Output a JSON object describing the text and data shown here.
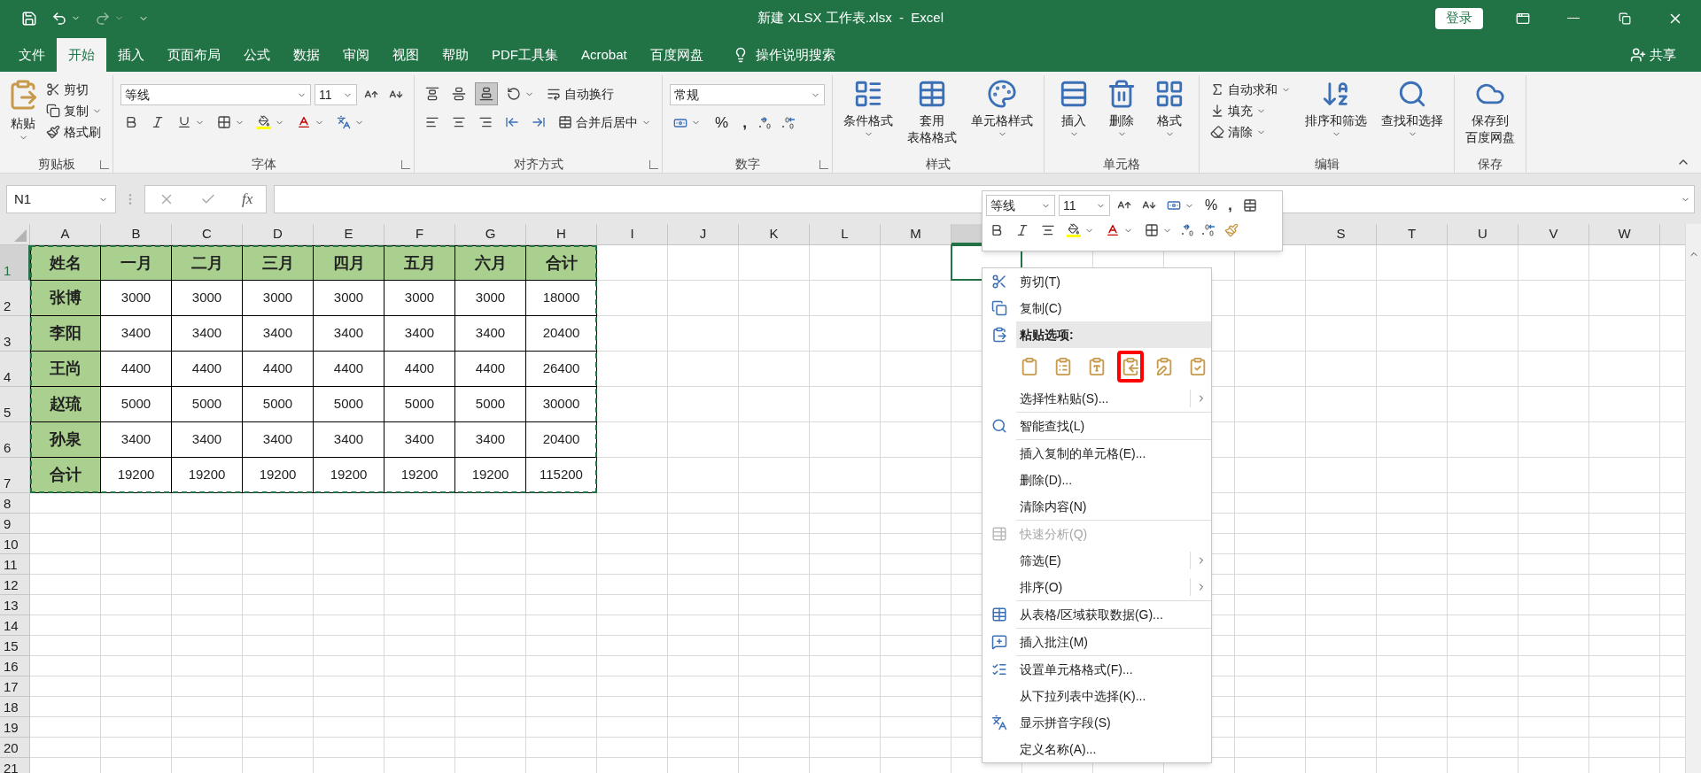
{
  "title_bar": {
    "title": "新建 XLSX 工作表.xlsx  -  Excel",
    "login": "登录"
  },
  "menu_tabs": [
    {
      "label": "文件",
      "selected": false
    },
    {
      "label": "开始",
      "selected": true
    },
    {
      "label": "插入",
      "selected": false
    },
    {
      "label": "页面布局",
      "selected": false
    },
    {
      "label": "公式",
      "selected": false
    },
    {
      "label": "数据",
      "selected": false
    },
    {
      "label": "审阅",
      "selected": false
    },
    {
      "label": "视图",
      "selected": false
    },
    {
      "label": "帮助",
      "selected": false
    },
    {
      "label": "PDF工具集",
      "selected": false
    },
    {
      "label": "Acrobat",
      "selected": false
    },
    {
      "label": "百度网盘",
      "selected": false
    }
  ],
  "tell_me": "操作说明搜索",
  "share": "共享",
  "ribbon": {
    "groups": [
      {
        "kind": "clipboard",
        "label": "剪贴板",
        "launcher": true,
        "paste": "粘贴",
        "items": [
          "剪切",
          "复制",
          "格式刷"
        ]
      },
      {
        "kind": "font",
        "label": "字体",
        "launcher": true,
        "font": "等线",
        "size": "11"
      },
      {
        "kind": "alignment",
        "label": "对齐方式",
        "launcher": true,
        "wrap": "自动换行",
        "merge": "合并后居中"
      },
      {
        "kind": "number",
        "label": "数字",
        "launcher": true,
        "format": "常规",
        "percent": "%",
        "comma": ","
      },
      {
        "kind": "styles",
        "label": "样式",
        "launcher": false,
        "buttons": [
          [
            "条件格式"
          ],
          [
            "套用",
            "表格格式"
          ],
          [
            "单元格样式"
          ]
        ]
      },
      {
        "kind": "cells",
        "label": "单元格",
        "launcher": false,
        "buttons": [
          "插入",
          "删除",
          "格式"
        ]
      },
      {
        "kind": "editing",
        "label": "编辑",
        "launcher": false,
        "small": [
          "自动求和",
          "填充",
          "清除"
        ],
        "big": [
          "排序和筛选",
          "查找和选择"
        ]
      },
      {
        "kind": "save",
        "label": "保存",
        "launcher": false,
        "button": [
          "保存到",
          "百度网盘"
        ]
      }
    ]
  },
  "formula_bar": {
    "name_box": "N1",
    "fx": "fx"
  },
  "sheet": {
    "columns": [
      {
        "label": "A",
        "selected": false
      },
      {
        "label": "B",
        "selected": false
      },
      {
        "label": "C",
        "selected": false
      },
      {
        "label": "D",
        "selected": false
      },
      {
        "label": "E",
        "selected": false
      },
      {
        "label": "F",
        "selected": false
      },
      {
        "label": "G",
        "selected": false
      },
      {
        "label": "H",
        "selected": false
      },
      {
        "label": "I",
        "selected": false
      },
      {
        "label": "J",
        "selected": false
      },
      {
        "label": "K",
        "selected": false
      },
      {
        "label": "L",
        "selected": false
      },
      {
        "label": "M",
        "selected": false
      },
      {
        "selected": true
      }
    ],
    "columns_right": [
      {
        "label": "S",
        "selected": false
      },
      {
        "label": "T",
        "selected": false
      },
      {
        "label": "U",
        "selected": false
      },
      {
        "label": "V",
        "selected": false
      },
      {
        "label": "W",
        "selected": false
      }
    ],
    "rows": [
      {
        "label": "1",
        "selected": true
      },
      {
        "label": "2",
        "selected": false
      },
      {
        "label": "3",
        "selected": false
      },
      {
        "label": "4",
        "selected": false
      },
      {
        "label": "5",
        "selected": false
      },
      {
        "label": "6",
        "selected": false
      },
      {
        "label": "7",
        "selected": false
      },
      {
        "label": "8",
        "selected": false
      },
      {
        "label": "9",
        "selected": false
      },
      {
        "label": "10",
        "selected": false
      },
      {
        "label": "11",
        "selected": false
      },
      {
        "label": "12",
        "selected": false
      },
      {
        "label": "13",
        "selected": false
      },
      {
        "label": "14",
        "selected": false
      },
      {
        "label": "15",
        "selected": false
      },
      {
        "label": "16",
        "selected": false
      },
      {
        "label": "17",
        "selected": false
      },
      {
        "label": "18",
        "selected": false
      },
      {
        "label": "19",
        "selected": false
      },
      {
        "label": "20",
        "selected": false
      },
      {
        "label": "21",
        "selected": false
      }
    ],
    "table": {
      "copied": true,
      "rows": [
        [
          "姓名",
          "一月",
          "二月",
          "三月",
          "四月",
          "五月",
          "六月",
          "合计"
        ],
        [
          "张博",
          "3000",
          "3000",
          "3000",
          "3000",
          "3000",
          "3000",
          "18000"
        ],
        [
          "李阳",
          "3400",
          "3400",
          "3400",
          "3400",
          "3400",
          "3400",
          "20400"
        ],
        [
          "王尚",
          "4400",
          "4400",
          "4400",
          "4400",
          "4400",
          "4400",
          "26400"
        ],
        [
          "赵琉",
          "5000",
          "5000",
          "5000",
          "5000",
          "5000",
          "5000",
          "30000"
        ],
        [
          "孙泉",
          "3400",
          "3400",
          "3400",
          "3400",
          "3400",
          "3400",
          "20400"
        ],
        [
          "合计",
          "19200",
          "19200",
          "19200",
          "19200",
          "19200",
          "19200",
          "115200"
        ]
      ]
    }
  },
  "mini_toolbar": {
    "font": "等线",
    "size": "11",
    "percent": "%",
    "comma": ","
  },
  "context_menu": {
    "sections": [
      [
        {
          "kind": "cut",
          "label": "剪切(T)",
          "disabled": false,
          "submenu": false
        },
        {
          "kind": "copy",
          "label": "复制(C)",
          "disabled": false,
          "submenu": false
        },
        {
          "kind": "header",
          "label": "粘贴选项:",
          "disabled": false,
          "submenu": false
        },
        {
          "kind": "paste_options",
          "options": [
            {
              "highlighted": false
            },
            {
              "highlighted": false
            },
            {
              "highlighted": false
            },
            {
              "highlighted": true
            },
            {
              "highlighted": false
            },
            {
              "highlighted": false
            }
          ]
        },
        {
          "kind": "plain",
          "label": "选择性粘贴(S)...",
          "disabled": false,
          "submenu": true
        }
      ],
      [
        {
          "kind": "lookup",
          "label": "智能查找(L)",
          "disabled": false,
          "submenu": false
        }
      ],
      [
        {
          "kind": "plain",
          "label": "插入复制的单元格(E)...",
          "disabled": false,
          "submenu": false
        },
        {
          "kind": "plain",
          "label": "删除(D)...",
          "disabled": false,
          "submenu": false
        },
        {
          "kind": "plain",
          "label": "清除内容(N)",
          "disabled": false,
          "submenu": false
        }
      ],
      [
        {
          "kind": "analysis",
          "label": "快速分析(Q)",
          "disabled": true,
          "submenu": false
        },
        {
          "kind": "plain",
          "label": "筛选(E)",
          "disabled": false,
          "submenu": true
        },
        {
          "kind": "plain",
          "label": "排序(O)",
          "disabled": false,
          "submenu": true
        }
      ],
      [
        {
          "kind": "table",
          "label": "从表格/区域获取数据(G)...",
          "disabled": false,
          "submenu": false
        }
      ],
      [
        {
          "kind": "comment",
          "label": "插入批注(M)",
          "disabled": false,
          "submenu": false
        }
      ],
      [
        {
          "kind": "format",
          "label": "设置单元格格式(F)...",
          "disabled": false,
          "submenu": false
        },
        {
          "kind": "plain",
          "label": "从下拉列表中选择(K)...",
          "disabled": false,
          "submenu": false
        },
        {
          "kind": "phonetic",
          "label": "显示拼音字段(S)",
          "disabled": false,
          "submenu": false
        },
        {
          "kind": "plain",
          "label": "定义名称(A)...",
          "disabled": false,
          "submenu": false
        }
      ]
    ]
  }
}
